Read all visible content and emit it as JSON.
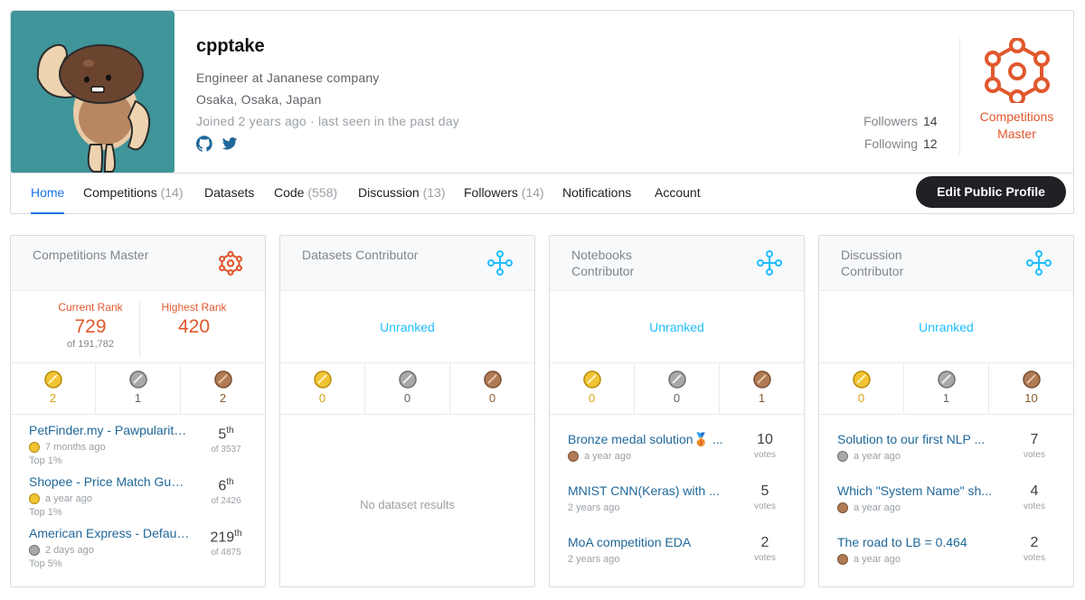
{
  "profile": {
    "name": "cpptake",
    "occupation": "Engineer at Jananese company",
    "location": "Osaka, Osaka, Japan",
    "joined": "Joined 2 years ago · last seen in the past day",
    "followers_label": "Followers",
    "followers_count": "14",
    "following_label": "Following",
    "following_count": "12",
    "tier_label": "Competitions Master",
    "tier_color": "#e1582d"
  },
  "nav": {
    "tabs": [
      {
        "label": "Home",
        "count": ""
      },
      {
        "label": "Competitions",
        "count": "(14)"
      },
      {
        "label": "Datasets",
        "count": ""
      },
      {
        "label": "Code",
        "count": "(558)"
      },
      {
        "label": "Discussion",
        "count": "(13)"
      },
      {
        "label": "Followers",
        "count": "(14)"
      },
      {
        "label": "Notifications",
        "count": ""
      },
      {
        "label": "Account",
        "count": ""
      }
    ],
    "edit_button": "Edit Public Profile"
  },
  "cards": [
    {
      "title": "Competitions Master",
      "current_rank_label": "Current Rank",
      "current_rank": "729",
      "current_rank_of": "of 191,782",
      "highest_rank_label": "Highest Rank",
      "highest_rank": "420",
      "medals": {
        "gold": "2",
        "silver": "1",
        "bronze": "2"
      },
      "items": [
        {
          "title": "PetFinder.my - Pawpularity Contest",
          "time": "7 months ago",
          "top": "Top 1%",
          "rank": "5",
          "suffix": "th",
          "of": "of 3537",
          "medal": "gold"
        },
        {
          "title": "Shopee - Price Match Guarantee",
          "time": "a year ago",
          "top": "Top 1%",
          "rank": "6",
          "suffix": "th",
          "of": "of 2426",
          "medal": "gold"
        },
        {
          "title": "American Express - Default Prediction",
          "time": "2 days ago",
          "top": "Top 5%",
          "rank": "219",
          "suffix": "th",
          "of": "of 4875",
          "medal": "silver"
        }
      ]
    },
    {
      "title": "Datasets Contributor",
      "rank_text": "Unranked",
      "medals": {
        "gold": "0",
        "silver": "0",
        "bronze": "0"
      },
      "empty_text": "No dataset results"
    },
    {
      "title": "Notebooks Contributor",
      "rank_text": "Unranked",
      "medals": {
        "gold": "0",
        "silver": "0",
        "bronze": "1"
      },
      "items": [
        {
          "title": "Bronze medal solution🥉 ...",
          "time": "a year ago",
          "medal": "bronze",
          "votes": "10",
          "votes_label": "votes"
        },
        {
          "title": "MNIST CNN(Keras) with ...",
          "time": "2 years ago",
          "medal": "",
          "votes": "5",
          "votes_label": "votes"
        },
        {
          "title": "MoA competition EDA",
          "time": "2 years ago",
          "medal": "",
          "votes": "2",
          "votes_label": "votes"
        }
      ]
    },
    {
      "title": "Discussion Contributor",
      "rank_text": "Unranked",
      "medals": {
        "gold": "0",
        "silver": "1",
        "bronze": "10"
      },
      "items": [
        {
          "title": "Solution to our first NLP ...",
          "time": "a year ago",
          "medal": "silver",
          "votes": "7",
          "votes_label": "votes"
        },
        {
          "title": "Which \"System Name\" sh...",
          "time": "a year ago",
          "medal": "bronze",
          "votes": "4",
          "votes_label": "votes"
        },
        {
          "title": "The road to LB = 0.464",
          "time": "a year ago",
          "medal": "bronze",
          "votes": "2",
          "votes_label": "votes"
        }
      ]
    }
  ],
  "colors": {
    "accent_blue": "#1a73e8",
    "contributor_blue": "#20beff",
    "master_orange": "#e1582d",
    "gold": "#f1c232",
    "silver": "#9e9e9e",
    "bronze": "#b07a55"
  },
  "icons": {
    "github": "github-icon",
    "twitter": "twitter-icon",
    "tier": "tier-hexagon-icon"
  }
}
